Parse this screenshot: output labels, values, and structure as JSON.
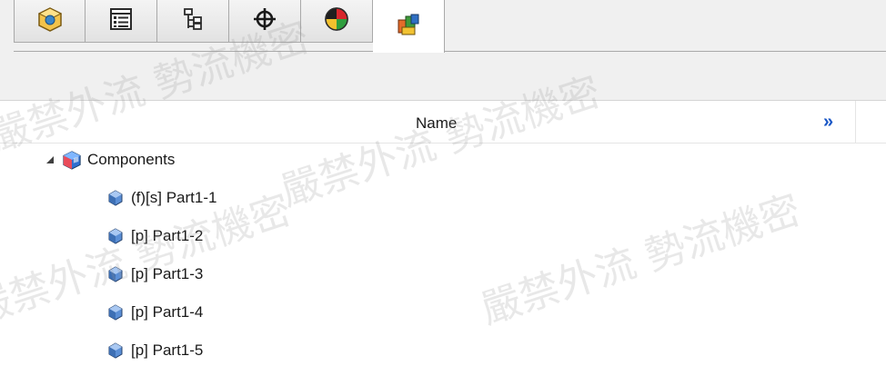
{
  "tabs": [
    {
      "id": "feature-manager",
      "icon": "part-cube-icon",
      "active": false
    },
    {
      "id": "property-manager",
      "icon": "property-list-icon",
      "active": false
    },
    {
      "id": "configuration-manager",
      "icon": "configuration-tree-icon",
      "active": false
    },
    {
      "id": "dim-xpert-manager",
      "icon": "crosshair-icon",
      "active": false
    },
    {
      "id": "display-manager",
      "icon": "appearance-sphere-icon",
      "active": false
    },
    {
      "id": "motion-manager",
      "icon": "assembly-components-icon",
      "active": true
    }
  ],
  "header": {
    "column_name": "Name",
    "more_label": "»"
  },
  "tree": {
    "root": {
      "label": "Components",
      "expanded": true
    },
    "items": [
      {
        "label": "(f)[s] Part1-1"
      },
      {
        "label": "[p] Part1-2"
      },
      {
        "label": "[p] Part1-3"
      },
      {
        "label": "[p] Part1-4"
      },
      {
        "label": "[p] Part1-5"
      }
    ]
  },
  "watermark_text": "嚴禁外流 勢流機密",
  "colors": {
    "accent": "#1a57c6",
    "tab_border": "#a9a9a9",
    "panel_bg": "#f0f0f0"
  }
}
